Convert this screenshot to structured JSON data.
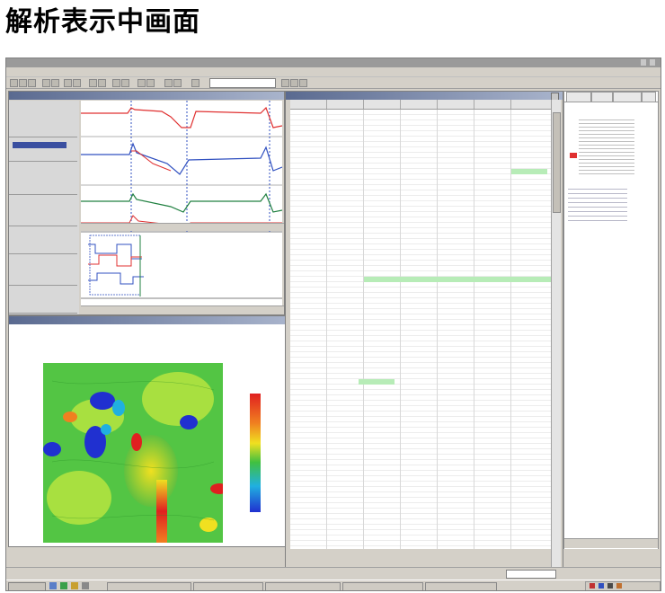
{
  "page": {
    "heading": "解析表示中画面"
  },
  "app": {
    "window_title": "",
    "menu_items": [],
    "toolbar_combo_value": ""
  },
  "waveform_panel": {
    "title": "",
    "channel_labels": [],
    "trace_colors": [
      "#e03030",
      "#3050c0",
      "#208040"
    ],
    "selected_channel_color": "#3a4fa0"
  },
  "map_panel": {
    "title": "",
    "header_text": "",
    "sub_label": "",
    "colorbar_tick_labels": [],
    "palette": [
      "#2030d0",
      "#20b0e0",
      "#40c040",
      "#a8e040",
      "#f0e020",
      "#f08020",
      "#e02020"
    ]
  },
  "table_panel": {
    "title": "",
    "column_headers": [],
    "highlight_color": "#b7ecb7"
  },
  "right_panel": {
    "tabs": [],
    "text_lines": []
  },
  "taskbar": {
    "start_label": "",
    "buttons": []
  }
}
